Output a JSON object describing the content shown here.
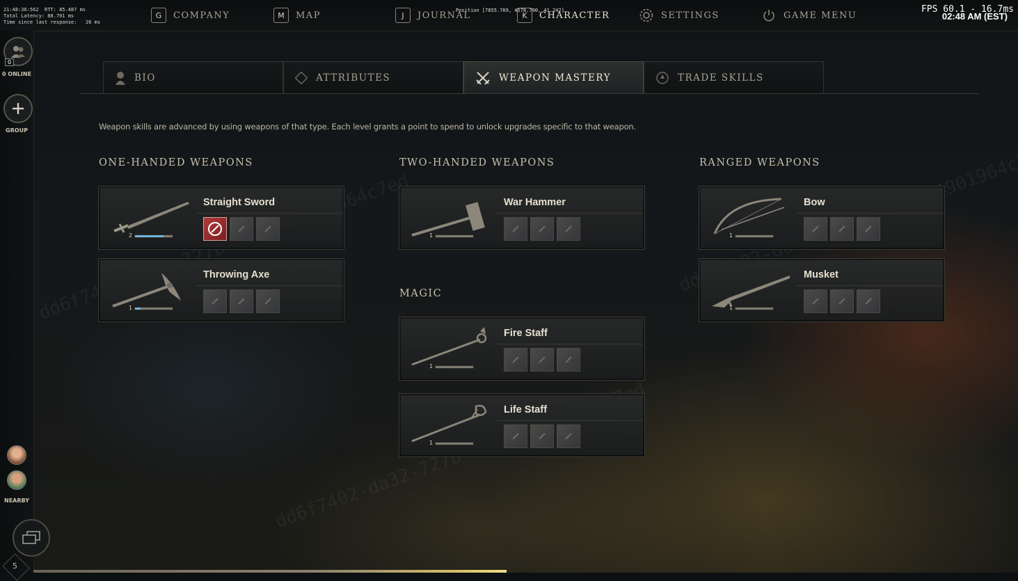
{
  "debug": {
    "lines": [
      "21:48:36:562  RTT: 85.487 ms",
      "Total Latency: 88.701 ms",
      "Time since last response:   26 ms"
    ],
    "position": "Position [7855.769, 4578.790, 41.242]",
    "fps": "FPS 60.1 - 16.7ms",
    "clock": "02:48 AM (EST)"
  },
  "nav": {
    "company": {
      "key": "G",
      "label": "COMPANY"
    },
    "map": {
      "key": "M",
      "label": "MAP"
    },
    "journal": {
      "key": "J",
      "label": "JOURNAL"
    },
    "character": {
      "key": "K",
      "label": "CHARACTER"
    },
    "settings": {
      "label": "SETTINGS",
      "icon": "gear-icon"
    },
    "game_menu": {
      "label": "GAME MENU",
      "icon": "power-icon"
    }
  },
  "sidebar": {
    "online_count": "0",
    "online_label": "0 ONLINE",
    "group_label": "GROUP",
    "nearby_label": "NEARBY",
    "chat_count": "5"
  },
  "tabs": [
    {
      "label": "BIO",
      "icon": "bust-icon"
    },
    {
      "label": "ATTRIBUTES",
      "icon": "xp-diamond-icon"
    },
    {
      "label": "WEAPON MASTERY",
      "icon": "crossed-swords-icon",
      "active": true
    },
    {
      "label": "TRADE SKILLS",
      "icon": "trade-icon"
    }
  ],
  "description": "Weapon skills are advanced by using weapons of that type. Each level grants a point to spend to unlock upgrades specific to that weapon.",
  "sections": {
    "one_handed": "ONE-HANDED WEAPONS",
    "two_handed": "TWO-HANDED WEAPONS",
    "ranged": "RANGED WEAPONS",
    "magic": "MAGIC"
  },
  "weapons": {
    "straight_sword": {
      "name": "Straight Sword",
      "level": "2",
      "progress": 0.75,
      "icon": "sword-icon"
    },
    "throwing_axe": {
      "name": "Throwing Axe",
      "level": "1",
      "progress": 0.15,
      "icon": "axe-icon"
    },
    "war_hammer": {
      "name": "War Hammer",
      "level": "1",
      "progress": 0,
      "icon": "hammer-icon"
    },
    "fire_staff": {
      "name": "Fire Staff",
      "level": "1",
      "progress": 0,
      "icon": "fire-staff-icon"
    },
    "life_staff": {
      "name": "Life Staff",
      "level": "1",
      "progress": 0,
      "icon": "life-staff-icon"
    },
    "bow": {
      "name": "Bow",
      "level": "1",
      "progress": 0,
      "icon": "bow-icon"
    },
    "musket": {
      "name": "Musket",
      "level": "1",
      "progress": 0,
      "icon": "musket-icon"
    }
  },
  "colors": {
    "progress": "#6fb4d8",
    "active_slot": "#b33a3a",
    "accent": "#efe8d6"
  }
}
